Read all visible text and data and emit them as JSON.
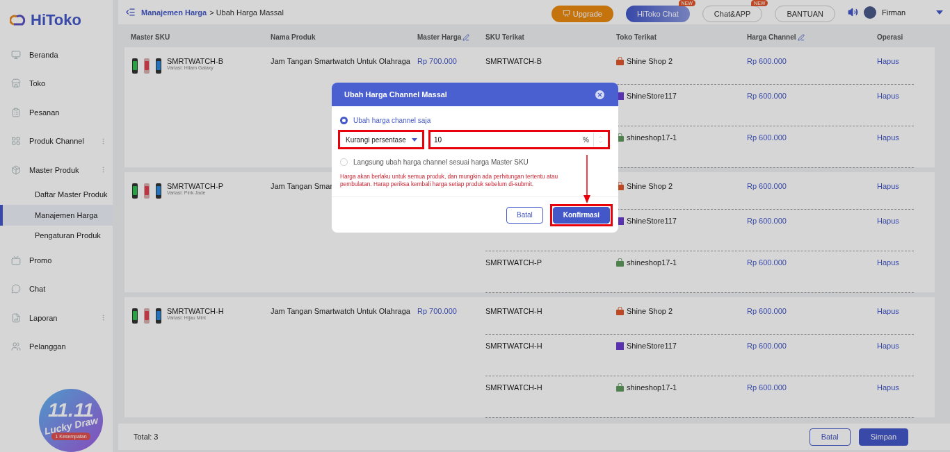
{
  "sidebar": {
    "logo": "HiToko",
    "items": [
      {
        "label": "Beranda",
        "expandable": false,
        "selected": false
      },
      {
        "label": "Toko",
        "expandable": false,
        "selected": false
      },
      {
        "label": "Pesanan",
        "expandable": false,
        "selected": false
      },
      {
        "label": "Produk Channel",
        "expandable": true,
        "selected": false
      },
      {
        "label": "Master Produk",
        "expandable": true,
        "selected": false,
        "children": [
          {
            "label": "Daftar Master Produk",
            "selected": false
          },
          {
            "label": "Manajemen Harga",
            "selected": true
          },
          {
            "label": "Pengaturan Produk",
            "selected": false
          }
        ]
      },
      {
        "label": "Promo",
        "expandable": false,
        "selected": false
      },
      {
        "label": "Chat",
        "expandable": false,
        "selected": false
      },
      {
        "label": "Laporan",
        "expandable": true,
        "selected": false
      },
      {
        "label": "Pelanggan",
        "expandable": false,
        "selected": false
      }
    ],
    "promo": {
      "title": "11.11",
      "subtitle": "Lucky Draw",
      "badge": "1 Kesempatan"
    }
  },
  "header": {
    "breadcrumb": {
      "link": "Manajemen Harga",
      "current": "> Ubah Harga Massal"
    },
    "buttons": [
      {
        "label": "Upgrade",
        "kind": "upgrade"
      },
      {
        "label": "HiToko Chat",
        "kind": "primary",
        "badge": "NEW"
      },
      {
        "label": "Chat&APP",
        "kind": "outline",
        "badge": "NEW"
      },
      {
        "label": "BANTUAN",
        "kind": "outline"
      }
    ],
    "user": "Firman"
  },
  "table": {
    "columns": [
      {
        "label": "Master SKU",
        "editable": false
      },
      {
        "label": "Nama Produk",
        "editable": false
      },
      {
        "label": "Master Harga",
        "editable": true
      },
      {
        "label": "SKU Terikat",
        "editable": false
      },
      {
        "label": "Toko Terikat",
        "editable": false
      },
      {
        "label": "Harga Channel",
        "editable": true
      },
      {
        "label": "Operasi",
        "editable": false
      }
    ],
    "rows": [
      {
        "sku": "SMRTWATCH-B",
        "variant": "Variasi: Hitam Galaxy",
        "product": "Jam Tangan Smartwatch Untuk Olahraga",
        "master_price": "Rp 700.000",
        "channels": [
          {
            "sku": "SMRTWATCH-B",
            "store": "Shine Shop 2",
            "kind": "bag",
            "price": "Rp 600.000",
            "action": "Hapus"
          },
          {
            "store": "ShineStore117",
            "kind": "tile",
            "price": "Rp 600.000",
            "action": "Hapus"
          },
          {
            "store": "shineshop17-1",
            "kind": "robot",
            "price": "Rp 600.000",
            "action": "Hapus"
          }
        ]
      },
      {
        "sku": "SMRTWATCH-P",
        "variant": "Variasi: Pink Jade",
        "product": "Jam Tangan Smar",
        "channels": [
          {
            "store": "Shine Shop 2",
            "kind": "bag",
            "price": "Rp 600.000",
            "action": "Hapus"
          },
          {
            "store": "ShineStore117",
            "kind": "tile",
            "price": "Rp 600.000",
            "action": "Hapus"
          },
          {
            "sku": "SMRTWATCH-P",
            "store": "shineshop17-1",
            "kind": "robot",
            "price": "Rp 600.000",
            "action": "Hapus"
          }
        ]
      },
      {
        "sku": "SMRTWATCH-H",
        "variant": "Variasi: Hijau Mint",
        "product": "Jam Tangan Smartwatch Untuk Olahraga",
        "master_price": "Rp 700.000",
        "channels": [
          {
            "sku": "SMRTWATCH-H",
            "store": "Shine Shop 2",
            "kind": "bag",
            "price": "Rp 600.000",
            "action": "Hapus"
          },
          {
            "sku": "SMRTWATCH-H",
            "store": "ShineStore117",
            "kind": "tile",
            "price": "Rp 600.000",
            "action": "Hapus"
          },
          {
            "sku": "SMRTWATCH-H",
            "store": "shineshop17-1",
            "kind": "robot",
            "price": "Rp 600.000",
            "action": "Hapus"
          }
        ]
      }
    ]
  },
  "footer": {
    "total": "Total: 3",
    "buttons": [
      {
        "label": "Batal",
        "kind": "secondary"
      },
      {
        "label": "Simpan",
        "kind": "primary"
      }
    ]
  },
  "modal": {
    "title": "Ubah Harga Channel Massal",
    "options": [
      {
        "label": "Ubah harga channel saja",
        "selected": true
      },
      {
        "label": "Langsung ubah harga channel sesuai harga Master SKU",
        "selected": false
      }
    ],
    "select": {
      "value": "Kurangi persentase",
      "highlighted": true
    },
    "input": {
      "value": "10",
      "unit": "%",
      "highlighted": true
    },
    "warning": "Harga akan berlaku untuk semua produk, dan mungkin ada perhitungan tertentu atau pembulatan. Harap periksa kembali harga setiap produk sebelum di-submit.",
    "annotation_arrow": true,
    "buttons": [
      {
        "label": "Batal",
        "kind": "secondary",
        "highlighted": false
      },
      {
        "label": "Konfirmasi",
        "kind": "primary",
        "highlighted": true
      }
    ]
  }
}
